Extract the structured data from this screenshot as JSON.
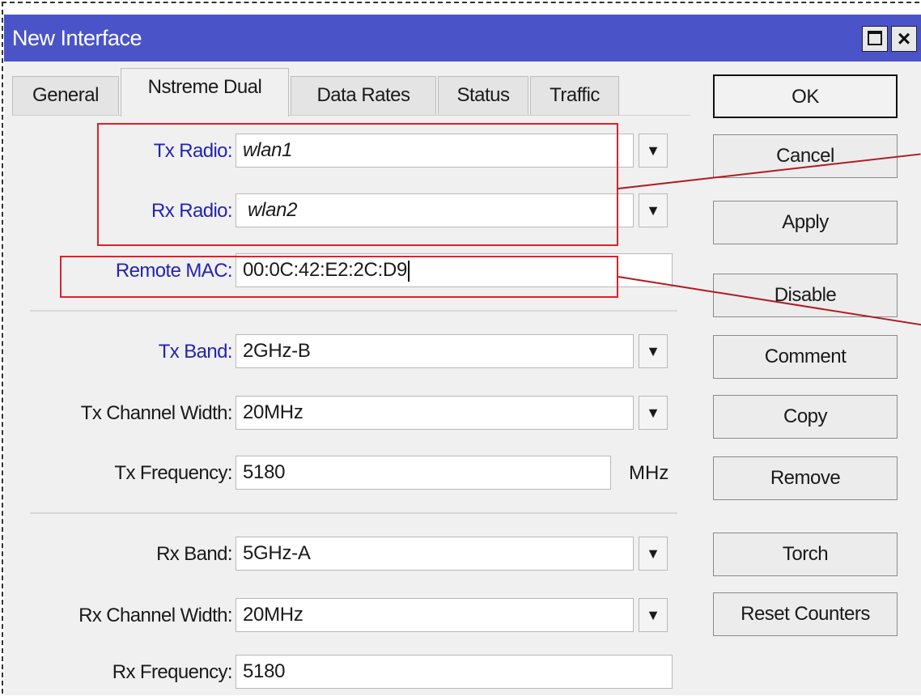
{
  "window": {
    "title": "New Interface"
  },
  "tabs": [
    "General",
    "Nstreme Dual",
    "Data Rates",
    "Status",
    "Traffic"
  ],
  "active_tab": "Nstreme Dual",
  "form": {
    "tx_radio": {
      "label": "Tx Radio:",
      "value": "wlan1"
    },
    "rx_radio": {
      "label": "Rx Radio:",
      "value": "wlan2"
    },
    "remote_mac": {
      "label": "Remote MAC:",
      "value": "00:0C:42:E2:2C:D9"
    },
    "tx_band": {
      "label": "Tx Band:",
      "value": "2GHz-B"
    },
    "tx_channel_width": {
      "label": "Tx Channel Width:",
      "value": "20MHz"
    },
    "tx_frequency": {
      "label": "Tx Frequency:",
      "value": "5180",
      "unit": "MHz"
    },
    "rx_band": {
      "label": "Rx Band:",
      "value": "5GHz-A"
    },
    "rx_channel_width": {
      "label": "Rx Channel Width:",
      "value": "20MHz"
    },
    "rx_frequency": {
      "label": "Rx Frequency:",
      "value": "5180"
    }
  },
  "buttons": {
    "ok": "OK",
    "cancel": "Cancel",
    "apply": "Apply",
    "disable": "Disable",
    "comment": "Comment",
    "copy": "Copy",
    "remove": "Remove",
    "torch": "Torch",
    "reset_counters": "Reset Counters"
  },
  "colors": {
    "titlebar": "#4a54c8",
    "label_highlight": "#2424b0",
    "annotation_box": "#e0202a"
  },
  "icons": {
    "dropdown": "dropdown-arrow-icon",
    "maximize": "maximize-icon",
    "close": "close-icon"
  }
}
